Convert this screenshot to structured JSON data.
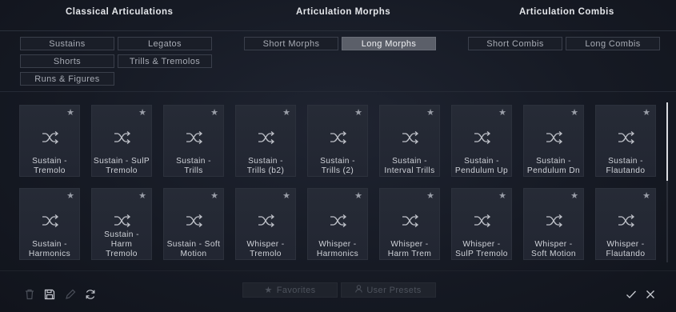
{
  "sections": {
    "classical": "Classical Articulations",
    "morphs": "Articulation Morphs",
    "combis": "Articulation Combis"
  },
  "classical_buttons": [
    "Sustains",
    "Legatos",
    "Shorts",
    "Trills & Tremolos",
    "Runs & Figures"
  ],
  "morph_buttons": [
    "Short Morphs",
    "Long Morphs"
  ],
  "combi_buttons": [
    "Short Combis",
    "Long Combis"
  ],
  "active_button": "Long Morphs",
  "tiles": [
    {
      "line1": "Sustain -",
      "line2": "Tremolo"
    },
    {
      "line1": "Sustain - SulP",
      "line2": "Tremolo"
    },
    {
      "line1": "Sustain -",
      "line2": "Trills"
    },
    {
      "line1": "Sustain -",
      "line2": "Trills (b2)"
    },
    {
      "line1": "Sustain -",
      "line2": "Trills (2)"
    },
    {
      "line1": "Sustain -",
      "line2": "Interval Trills"
    },
    {
      "line1": "Sustain -",
      "line2": "Pendulum Up"
    },
    {
      "line1": "Sustain -",
      "line2": "Pendulum Dn"
    },
    {
      "line1": "Sustain -",
      "line2": "Flautando"
    },
    {
      "line1": "Sustain -",
      "line2": "Harmonics"
    },
    {
      "line1": "Sustain -",
      "line2": "Harm",
      "line3": "Tremolo"
    },
    {
      "line1": "Sustain - Soft",
      "line2": "Motion"
    },
    {
      "line1": "Whisper -",
      "line2": "Tremolo"
    },
    {
      "line1": "Whisper -",
      "line2": "Harmonics"
    },
    {
      "line1": "Whisper -",
      "line2": "Harm Trem"
    },
    {
      "line1": "Whisper -",
      "line2": "SulP Tremolo"
    },
    {
      "line1": "Whisper -",
      "line2": "Soft Motion"
    },
    {
      "line1": "Whisper -",
      "line2": "Flautando"
    }
  ],
  "footer": {
    "favorites": "Favorites",
    "user_presets": "User Presets"
  },
  "icons": {
    "tile": "shuffle-icon",
    "favorite": "star-icon",
    "delete": "trash-icon",
    "save": "save-icon",
    "edit": "pencil-icon",
    "refresh": "refresh-icon",
    "confirm": "check-icon",
    "close": "close-icon"
  }
}
